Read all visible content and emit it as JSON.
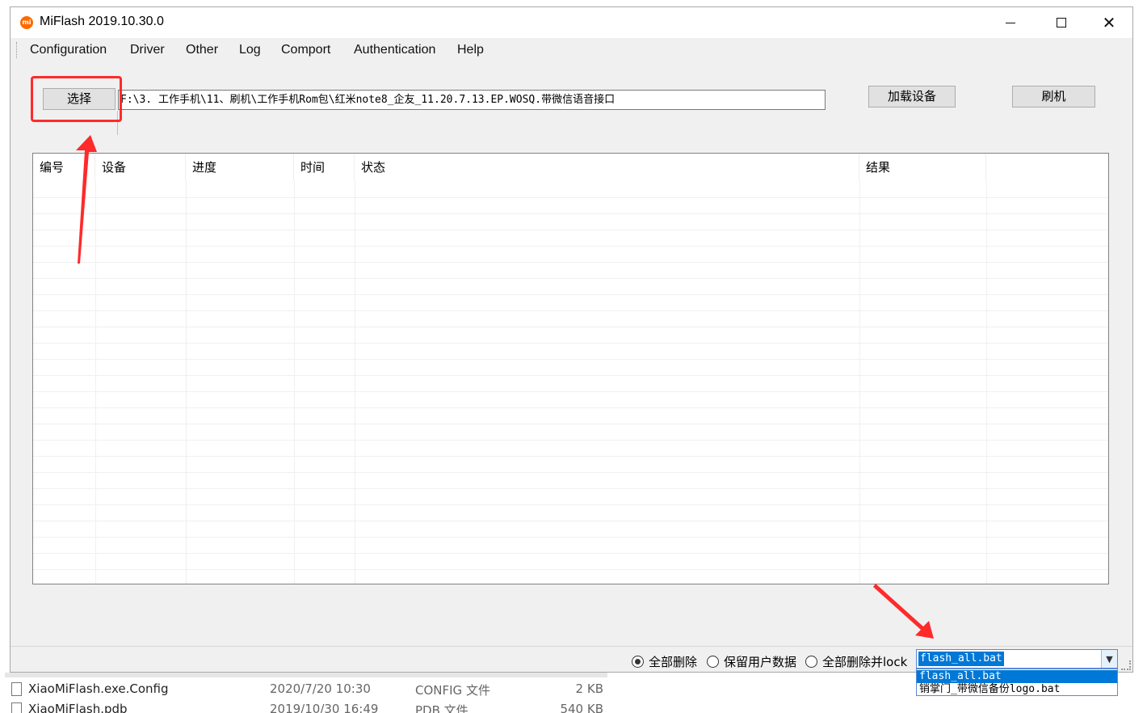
{
  "window": {
    "title": "MiFlash 2019.10.30.0",
    "icon_text": "mi"
  },
  "menu": {
    "items": [
      "Configuration",
      "Driver",
      "Other",
      "Log",
      "Comport",
      "Authentication",
      "Help"
    ]
  },
  "toolbar": {
    "select_label": "选择",
    "path_value": "F:\\3. 工作手机\\11、刷机\\工作手机Rom包\\红米note8_企友_11.20.7.13.EP.WOSQ.带微信语音接口",
    "load_label": "加载设备",
    "flash_label": "刷机"
  },
  "table": {
    "columns": [
      "编号",
      "设备",
      "进度",
      "时间",
      "状态",
      "结果"
    ]
  },
  "options": {
    "radios": [
      {
        "label": "全部删除",
        "checked": true
      },
      {
        "label": "保留用户数据",
        "checked": false
      },
      {
        "label": "全部删除并lock",
        "checked": false
      }
    ],
    "script_selected": "flash_all.bat",
    "script_options": [
      "flash_all.bat",
      "销掌门_带微信备份logo.bat"
    ]
  },
  "explorer_files": [
    {
      "name": "XiaoMiFlash.exe.Config",
      "date": "2020/7/20 10:30",
      "type": "CONFIG 文件",
      "size": "2 KB"
    },
    {
      "name": "XiaoMiFlash.pdb",
      "date": "2019/10/30 16:49",
      "type": "PDB 文件",
      "size": "540 KB"
    }
  ],
  "colors": {
    "accent": "#0078d7",
    "annotation": "#ff2a2a",
    "brand": "#ff6900"
  }
}
